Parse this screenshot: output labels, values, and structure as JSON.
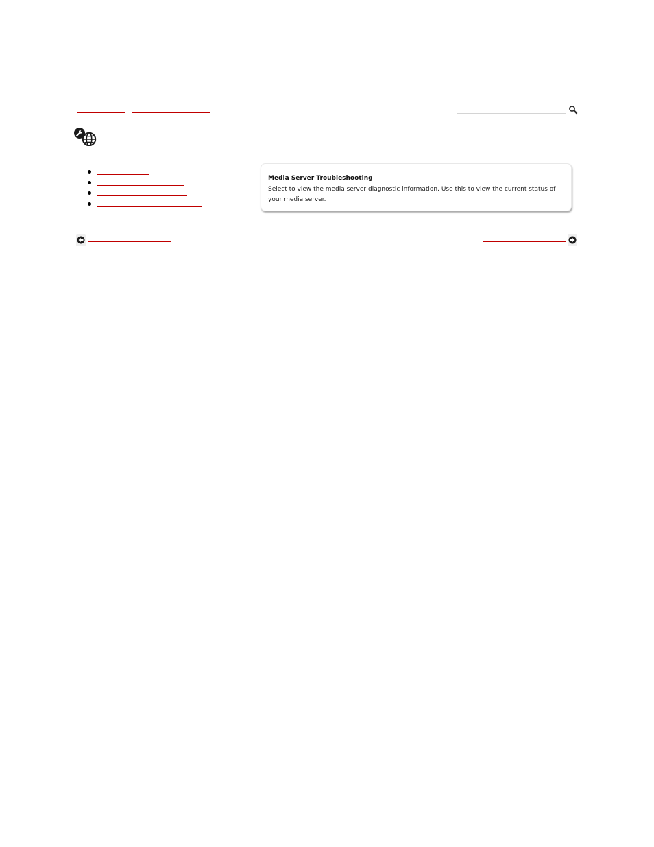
{
  "breadcrumb": {
    "items": [
      {
        "label": ""
      },
      {
        "label": ""
      }
    ]
  },
  "search": {
    "value": "",
    "placeholder": "",
    "button_icon": "magnifier-icon"
  },
  "category_icon": "tools-globe-icon",
  "toc": {
    "items": [
      {
        "label": ""
      },
      {
        "label": ""
      },
      {
        "label": ""
      },
      {
        "label": ""
      }
    ]
  },
  "panel": {
    "title": "Media Server Troubleshooting",
    "description": "Select to view the media server diagnostic information. Use this to view the current status of your media server."
  },
  "nav": {
    "prev_label": "",
    "next_label": "",
    "prev_icon": "arrow-left-icon",
    "next_icon": "arrow-right-icon"
  },
  "colors": {
    "link": "#c00000",
    "panel_border": "#e8e8e8"
  }
}
